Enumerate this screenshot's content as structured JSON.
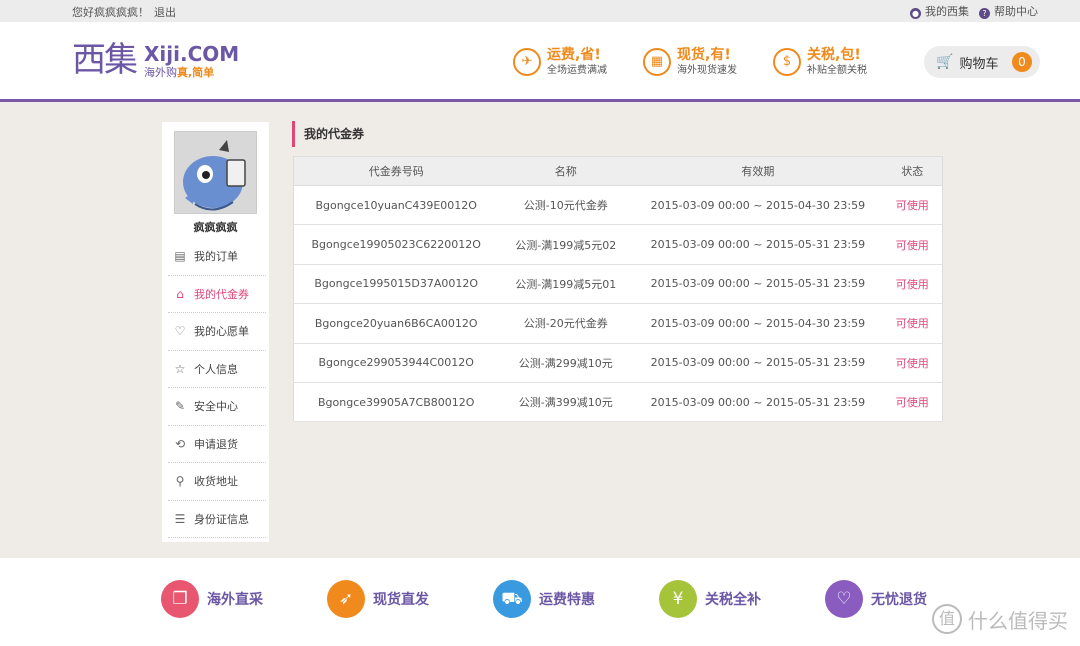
{
  "topbar": {
    "greeting": "您好疯疯疯疯！",
    "logout": "退出",
    "my_xiji": "我的西集",
    "help_center": "帮助中心"
  },
  "header": {
    "logo_cn": "西集",
    "logo_en": "Xiji.COM",
    "slogan_a": "海外购",
    "slogan_b": "真,简单",
    "promos": [
      {
        "title": "运费,省!",
        "subtitle": "全场运费满减",
        "icon": "airplane-icon"
      },
      {
        "title": "现货,有!",
        "subtitle": "海外现货速发",
        "icon": "package-icon"
      },
      {
        "title": "关税,包!",
        "subtitle": "补贴全额关税",
        "icon": "money-bag-icon"
      }
    ],
    "cart_label": "购物车",
    "cart_count": "0"
  },
  "sidebar": {
    "username": "疯疯疯疯",
    "items": [
      {
        "label": "我的订单",
        "icon": "order-icon"
      },
      {
        "label": "我的代金券",
        "icon": "coupon-tag-icon"
      },
      {
        "label": "我的心愿单",
        "icon": "heart-icon"
      },
      {
        "label": "个人信息",
        "icon": "star-icon"
      },
      {
        "label": "安全中心",
        "icon": "edit-icon"
      },
      {
        "label": "申请退货",
        "icon": "refresh-icon"
      },
      {
        "label": "收货地址",
        "icon": "location-pin-icon"
      },
      {
        "label": "身份证信息",
        "icon": "id-card-icon"
      }
    ]
  },
  "main": {
    "title": "我的代金券",
    "columns": [
      "代金券号码",
      "名称",
      "有效期",
      "状态"
    ],
    "rows": [
      [
        "Bgongce10yuanC439E0012O",
        "公测-10元代金券",
        "2015-03-09 00:00 ~ 2015-04-30 23:59",
        "可使用"
      ],
      [
        "Bgongce19905023C6220012O",
        "公测-满199减5元02",
        "2015-03-09 00:00 ~ 2015-05-31 23:59",
        "可使用"
      ],
      [
        "Bgongce1995015D37A0012O",
        "公测-满199减5元01",
        "2015-03-09 00:00 ~ 2015-05-31 23:59",
        "可使用"
      ],
      [
        "Bgongce20yuan6B6CA0012O",
        "公测-20元代金券",
        "2015-03-09 00:00 ~ 2015-04-30 23:59",
        "可使用"
      ],
      [
        "Bgongce299053944C0012O",
        "公测-满299减10元",
        "2015-03-09 00:00 ~ 2015-05-31 23:59",
        "可使用"
      ],
      [
        "Bgongce39905A7CB80012O",
        "公测-满399减10元",
        "2015-03-09 00:00 ~ 2015-05-31 23:59",
        "可使用"
      ]
    ]
  },
  "footer": {
    "features": [
      {
        "label": "海外直采",
        "color": "#e8566f",
        "icon": "bag-icon"
      },
      {
        "label": "现货直发",
        "color": "#f08a1c",
        "icon": "rocket-icon"
      },
      {
        "label": "运费特惠",
        "color": "#3a9ae0",
        "icon": "truck-icon"
      },
      {
        "label": "关税全补",
        "color": "#a5c43a",
        "icon": "piggy-bank-icon"
      },
      {
        "label": "无忧退货",
        "color": "#8a5cc0",
        "icon": "return-icon"
      }
    ],
    "watermark": "什么值得买"
  },
  "colors": {
    "brand_purple": "#6b57a6",
    "accent_orange": "#f08a1c",
    "status_pink": "#e0457a"
  }
}
